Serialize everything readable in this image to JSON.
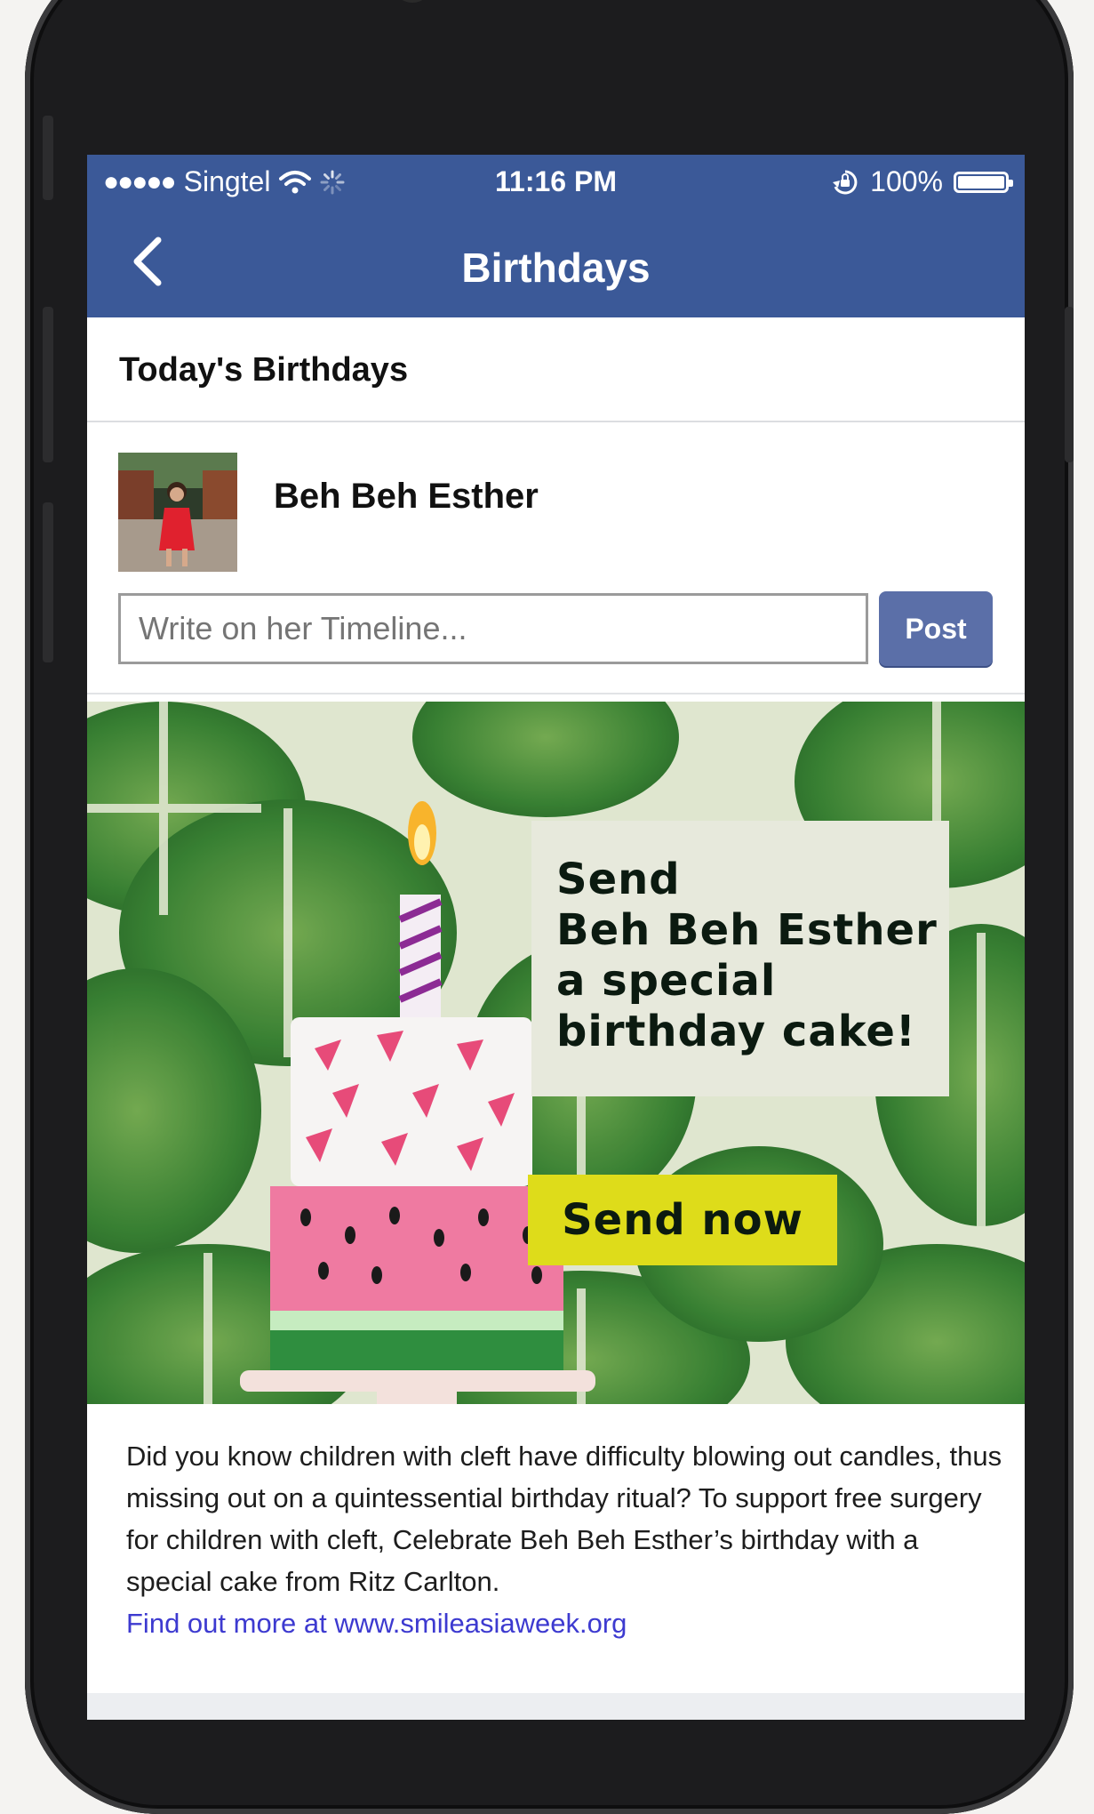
{
  "status_bar": {
    "signal_dots": "●●●●●",
    "carrier": "Singtel",
    "time": "11:16 PM",
    "battery_percent": "100%",
    "battery_level": 1.0
  },
  "nav": {
    "title": "Birthdays",
    "back_icon": "chevron-left-icon"
  },
  "section": {
    "heading": "Today's Birthdays"
  },
  "person": {
    "name": "Beh Beh Esther",
    "composer_placeholder": "Write on her Timeline...",
    "post_label": "Post"
  },
  "ad": {
    "headline_line1": "Send",
    "headline_line2": "Beh Beh Esther",
    "headline_line3": "a special",
    "headline_line4": "birthday cake!",
    "cta_label": "Send now"
  },
  "description": {
    "text": "Did you know children with cleft have difficulty blowing out candles, thus missing out on a quintessential birthday ritual? To support free surgery for children with cleft, Celebrate Beh Beh Esther’s birthday with a special cake from Ritz Carlton.",
    "link": "Find out more at www.smileasiaweek.org"
  },
  "colors": {
    "facebook_blue": "#3b5998",
    "post_button": "#5b6fa8",
    "cta_yellow": "#dedc1a",
    "link_blue": "#3d3ad0"
  }
}
